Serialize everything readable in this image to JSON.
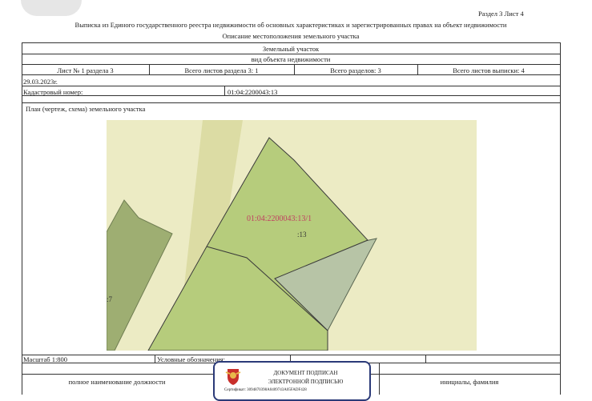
{
  "header": {
    "section_sheet": "Раздел 3   Лист 4",
    "title_line1": "Выписка из Единого государственного реестра недвижимости об основных характеристиках и зарегистрированных правах на объект недвижимости",
    "title_line2": "Описание местоположения земельного участка"
  },
  "table": {
    "object_type": "Земельный участок",
    "object_type_caption": "вид объекта недвижимости",
    "cells": [
      "Лист № 1 раздела 3",
      "Всего листов раздела 3: 1",
      "Всего разделов: 3",
      "Всего листов выписки: 4"
    ],
    "date": "29.03.2023г.",
    "cadastral_label": "Кадастровый номер:",
    "cadastral_value": "01:04:2200043:13",
    "plan_label": "План (чертеж, схема) земельного участка"
  },
  "map": {
    "parcel_label": "01:04:2200043:13/1",
    "parcel_number": ":13",
    "side_label": ":7",
    "colors": {
      "background": "#ecebc4",
      "road": "#dcdca4",
      "parcel": "#b6cc7c",
      "neighbor_left": "#9eae72",
      "neighbor_right": "#b7c4a6",
      "label": "#c04060"
    }
  },
  "footer": {
    "scale": "Масштаб 1:800",
    "legend": "Условные обозначения:",
    "position_label": "полное наименование должности",
    "name_label": "инициалы, фамилия"
  },
  "stamp": {
    "line1": "ДОКУМЕНТ ПОДПИСАН",
    "line2": "ЭЛЕКТРОННОЙ ПОДПИСЬЮ",
    "line3": "Сертификат: 3094870398A0409743A05FADF428",
    "color": "#2b3a78"
  }
}
